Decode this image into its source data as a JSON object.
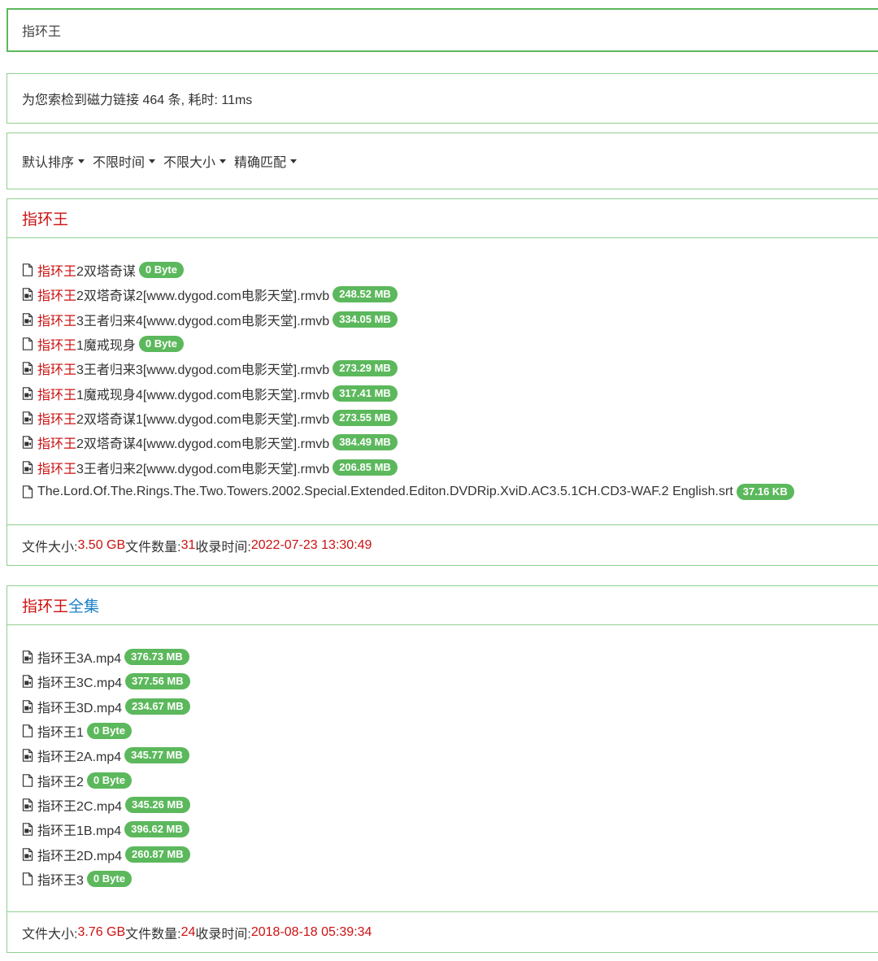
{
  "search": {
    "value": "指环王"
  },
  "stats": {
    "text": "为您索检到磁力链接 464 条, 耗时: 11ms"
  },
  "filters": [
    "默认排序",
    "不限时间",
    "不限大小",
    "精确匹配"
  ],
  "results": [
    {
      "title_highlight": "指环王",
      "title_rest": "",
      "files": [
        {
          "icon": "file-icon",
          "hl": "指环王",
          "name": "2双塔奇谋",
          "size": "0 Byte"
        },
        {
          "icon": "video-file-icon",
          "hl": "指环王",
          "name": "2双塔奇谋2[www.dygod.com电影天堂].rmvb",
          "size": "248.52 MB"
        },
        {
          "icon": "video-file-icon",
          "hl": "指环王",
          "name": "3王者归来4[www.dygod.com电影天堂].rmvb",
          "size": "334.05 MB"
        },
        {
          "icon": "file-icon",
          "hl": "指环王",
          "name": "1魔戒现身",
          "size": "0 Byte"
        },
        {
          "icon": "video-file-icon",
          "hl": "指环王",
          "name": "3王者归来3[www.dygod.com电影天堂].rmvb",
          "size": "273.29 MB"
        },
        {
          "icon": "video-file-icon",
          "hl": "指环王",
          "name": "1魔戒现身4[www.dygod.com电影天堂].rmvb",
          "size": "317.41 MB"
        },
        {
          "icon": "video-file-icon",
          "hl": "指环王",
          "name": "2双塔奇谋1[www.dygod.com电影天堂].rmvb",
          "size": "273.55 MB"
        },
        {
          "icon": "video-file-icon",
          "hl": "指环王",
          "name": "2双塔奇谋4[www.dygod.com电影天堂].rmvb",
          "size": "384.49 MB"
        },
        {
          "icon": "video-file-icon",
          "hl": "指环王",
          "name": "3王者归来2[www.dygod.com电影天堂].rmvb",
          "size": "206.85 MB"
        },
        {
          "icon": "file-icon",
          "hl": "",
          "name": "The.Lord.Of.The.Rings.The.Two.Towers.2002.Special.Extended.Editon.DVDRip.XviD.AC3.5.1CH.CD3-WAF.2 English.srt",
          "size": "37.16 KB"
        }
      ],
      "footer": {
        "size_label": "文件大小: ",
        "size": "3.50 GB",
        "count_label": " 文件数量: ",
        "count": "31",
        "time_label": " 收录时间: ",
        "time": "2022-07-23 13:30:49"
      }
    },
    {
      "title_highlight": "指环王",
      "title_rest": "全集",
      "files": [
        {
          "icon": "video-file-icon",
          "hl": "",
          "name": "指环王3A.mp4",
          "size": "376.73 MB"
        },
        {
          "icon": "video-file-icon",
          "hl": "",
          "name": "指环王3C.mp4",
          "size": "377.56 MB"
        },
        {
          "icon": "video-file-icon",
          "hl": "",
          "name": "指环王3D.mp4",
          "size": "234.67 MB"
        },
        {
          "icon": "file-icon",
          "hl": "",
          "name": "指环王1",
          "size": "0 Byte"
        },
        {
          "icon": "video-file-icon",
          "hl": "",
          "name": "指环王2A.mp4",
          "size": "345.77 MB"
        },
        {
          "icon": "file-icon",
          "hl": "",
          "name": "指环王2",
          "size": "0 Byte"
        },
        {
          "icon": "video-file-icon",
          "hl": "",
          "name": "指环王2C.mp4",
          "size": "345.26 MB"
        },
        {
          "icon": "video-file-icon",
          "hl": "",
          "name": "指环王1B.mp4",
          "size": "396.62 MB"
        },
        {
          "icon": "video-file-icon",
          "hl": "",
          "name": "指环王2D.mp4",
          "size": "260.87 MB"
        },
        {
          "icon": "file-icon",
          "hl": "",
          "name": "指环王3",
          "size": "0 Byte"
        }
      ],
      "footer": {
        "size_label": "文件大小: ",
        "size": "3.76 GB",
        "count_label": " 文件数量: ",
        "count": "24",
        "time_label": " 收录时间: ",
        "time": "2018-08-18 05:39:34"
      }
    }
  ],
  "colors": {
    "accent_green": "#5cb85c",
    "highlight_red": "#cc1111",
    "title_blue": "#1a7fc4"
  }
}
